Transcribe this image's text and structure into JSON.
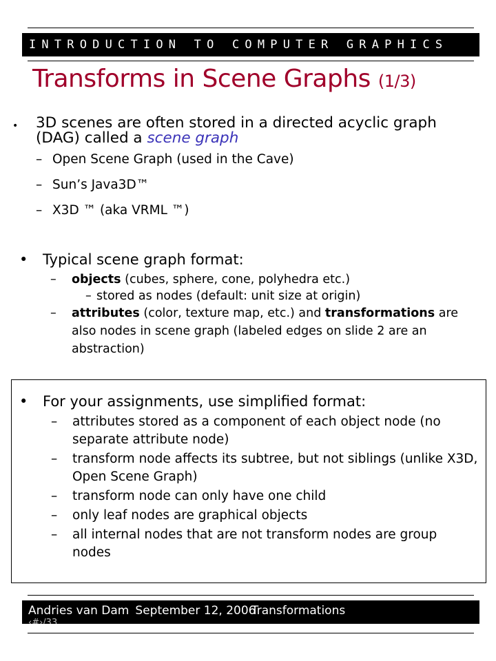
{
  "header": {
    "course": "INTRODUCTION TO COMPUTER GRAPHICS"
  },
  "slide": {
    "title": "Transforms in Scene Graphs",
    "page_indicator": "(1/3)"
  },
  "section1": {
    "bullet": {
      "text_before": "3D scenes are often stored in a directed acyclic graph (DAG) called a ",
      "emphasis": "scene graph"
    },
    "items": [
      "Open Scene Graph (used in the Cave)",
      "Sun’s Java3D™",
      "X3D ™ (aka VRML ™)"
    ]
  },
  "section2": {
    "bullet": "Typical scene graph format:",
    "item1_bold": "objects",
    "item1_rest": " (cubes, sphere, cone, polyhedra etc.)",
    "item1_sub": "stored as nodes (default: unit size at origin)",
    "item2_bold1": "attributes",
    "item2_rest1": " (color, texture map, etc.) and ",
    "item2_bold2": "transformations",
    "item2_rest2": " are also nodes in scene graph (labeled edges on slide 2 are an abstraction)"
  },
  "section3": {
    "bullet": "For your assignments, use simplified format:",
    "items": [
      "attributes stored as a component of each object node (no separate attribute node)",
      "transform node affects its subtree, but not siblings (unlike X3D, Open Scene Graph)",
      "transform node can only have one child",
      "only leaf nodes are graphical objects",
      "all internal nodes that are not transform nodes are group nodes"
    ]
  },
  "footer": {
    "author": "Andries van Dam",
    "date": "September 12, 2006",
    "topic": "Transformations",
    "page": "‹#›/33"
  },
  "colors": {
    "title": "#a0002a",
    "emphasis": "#3a32b8",
    "bars": "#000000"
  }
}
